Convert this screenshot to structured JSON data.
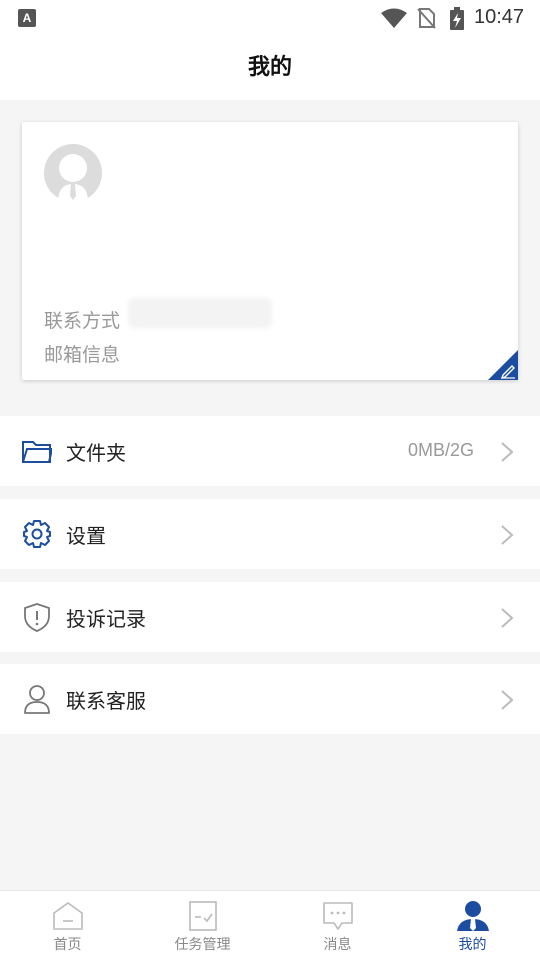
{
  "status_bar": {
    "badge": "A",
    "time": "10:47"
  },
  "header": {
    "title": "我的"
  },
  "profile": {
    "contact_label": "联系方式",
    "email_label": "邮箱信息"
  },
  "menu": [
    {
      "label": "文件夹",
      "value": "0MB/2G",
      "icon": "folder-icon"
    },
    {
      "label": "设置",
      "value": "",
      "icon": "gear-icon"
    },
    {
      "label": "投诉记录",
      "value": "",
      "icon": "shield-icon"
    },
    {
      "label": "联系客服",
      "value": "",
      "icon": "person-icon"
    }
  ],
  "tabs": [
    {
      "label": "首页",
      "icon": "home-icon",
      "active": false
    },
    {
      "label": "任务管理",
      "icon": "task-icon",
      "active": false
    },
    {
      "label": "消息",
      "icon": "message-icon",
      "active": false
    },
    {
      "label": "我的",
      "icon": "profile-icon",
      "active": true
    }
  ],
  "colors": {
    "accent": "#1d4da1",
    "background": "#f5f5f5",
    "muted_text": "#999999"
  }
}
